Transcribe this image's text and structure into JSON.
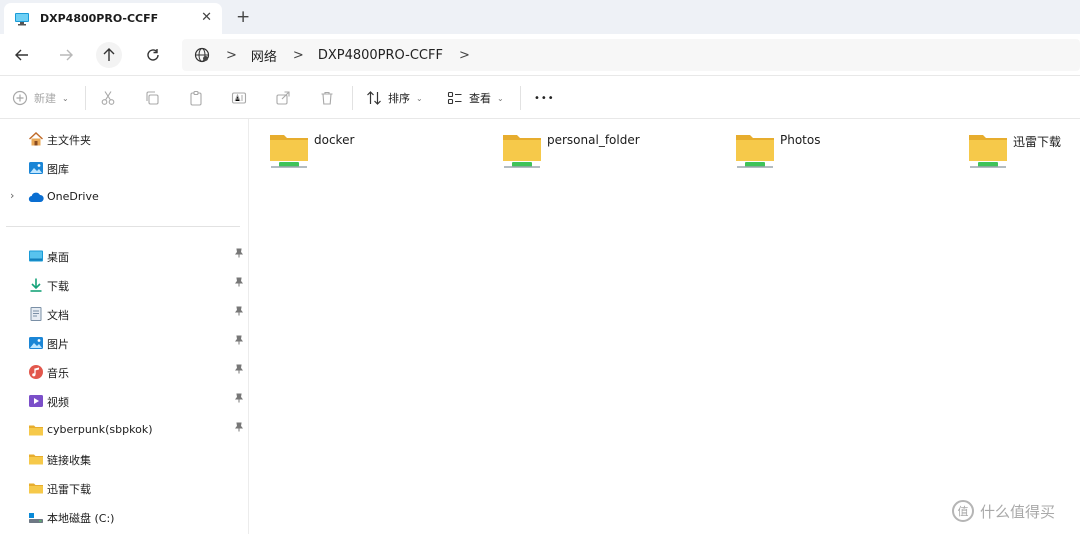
{
  "window": {
    "tab_title": "DXP4800PRO-CCFF",
    "tab_close_glyph": "✕",
    "new_tab_glyph": "+"
  },
  "address": {
    "root": "网络",
    "current": "DXP4800PRO-CCFF",
    "separator": ">"
  },
  "commands": {
    "new_label": "新建",
    "sort_label": "排序",
    "view_label": "查看",
    "more_glyph": "•••"
  },
  "sidebar": {
    "top_items": [
      {
        "label": "主文件夹",
        "icon": "home-icon"
      },
      {
        "label": "图库",
        "icon": "gallery-icon"
      },
      {
        "label": "OneDrive",
        "icon": "cloud-icon"
      }
    ],
    "quick_access": [
      {
        "label": "桌面",
        "icon": "desktop-icon",
        "pinned": true
      },
      {
        "label": "下载",
        "icon": "download-icon",
        "pinned": true
      },
      {
        "label": "文档",
        "icon": "document-icon",
        "pinned": true
      },
      {
        "label": "图片",
        "icon": "picture-icon",
        "pinned": true
      },
      {
        "label": "音乐",
        "icon": "music-icon",
        "pinned": true
      },
      {
        "label": "视频",
        "icon": "video-icon",
        "pinned": true
      },
      {
        "label": "cyberpunk(sbpkok)",
        "icon": "folder-icon",
        "pinned": true
      },
      {
        "label": "链接收集",
        "icon": "folder-icon",
        "pinned": false
      },
      {
        "label": "迅雷下载",
        "icon": "folder-icon",
        "pinned": false
      },
      {
        "label": "本地磁盘 (C:)",
        "icon": "drive-icon",
        "pinned": false
      }
    ],
    "expand_glyph": "›",
    "pin_glyph": "📌"
  },
  "content": {
    "folders": [
      {
        "name": "docker"
      },
      {
        "name": "personal_folder"
      },
      {
        "name": "Photos"
      },
      {
        "name": "迅雷下载"
      }
    ]
  },
  "watermark": {
    "logo_text": "值",
    "text": "什么值得买"
  },
  "colors": {
    "folder_yellow": "#f6c94a",
    "folder_back": "#e7ad2e",
    "network_green": "#3fc35a",
    "accent_blue": "#0078d4",
    "onedrive_blue": "#0a6ed1"
  }
}
